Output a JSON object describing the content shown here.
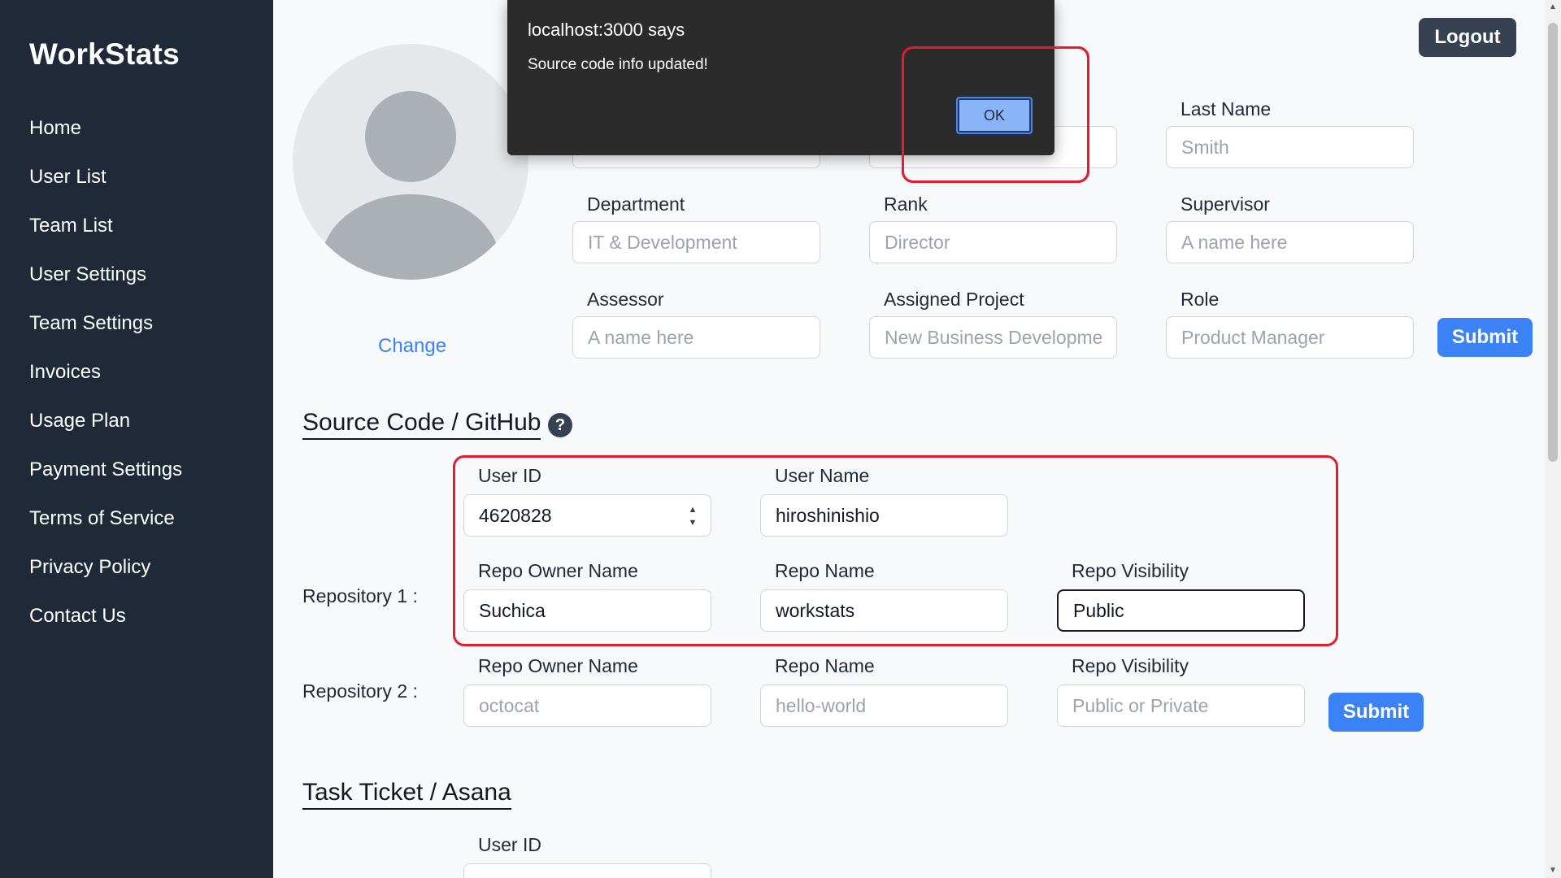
{
  "app": {
    "brand": "WorkStats"
  },
  "sidebar": {
    "items": [
      {
        "label": "Home"
      },
      {
        "label": "User List"
      },
      {
        "label": "Team List"
      },
      {
        "label": "User Settings"
      },
      {
        "label": "Team Settings"
      },
      {
        "label": "Invoices"
      },
      {
        "label": "Usage Plan"
      },
      {
        "label": "Payment Settings"
      },
      {
        "label": "Terms of Service"
      },
      {
        "label": "Privacy Policy"
      },
      {
        "label": "Contact Us"
      }
    ]
  },
  "header": {
    "logout_label": "Logout"
  },
  "profile": {
    "change_label": "Change",
    "last_name_label": "Last Name",
    "last_name_placeholder": "Smith",
    "department_label": "Department",
    "department_placeholder": "IT & Development",
    "rank_label": "Rank",
    "rank_placeholder": "Director",
    "supervisor_label": "Supervisor",
    "supervisor_placeholder": "A name here",
    "assessor_label": "Assessor",
    "assessor_placeholder": "A name here",
    "assigned_project_label": "Assigned Project",
    "assigned_project_placeholder": "New Business Developme",
    "role_label": "Role",
    "role_placeholder": "Product Manager",
    "submit_label": "Submit"
  },
  "source_code": {
    "title": "Source Code / GitHub",
    "help_icon": "?",
    "user_id_label": "User ID",
    "user_id_value": "4620828",
    "user_name_label": "User Name",
    "user_name_value": "hiroshinishio",
    "repo1": {
      "label": "Repository 1 :",
      "owner_label": "Repo Owner Name",
      "owner_value": "Suchica",
      "name_label": "Repo Name",
      "name_value": "workstats",
      "visibility_label": "Repo Visibility",
      "visibility_value": "Public"
    },
    "repo2": {
      "label": "Repository 2 :",
      "owner_label": "Repo Owner Name",
      "owner_placeholder": "octocat",
      "name_label": "Repo Name",
      "name_placeholder": "hello-world",
      "visibility_label": "Repo Visibility",
      "visibility_placeholder": "Public or Private"
    },
    "submit_label": "Submit"
  },
  "task_ticket": {
    "title": "Task Ticket / Asana",
    "user_id_label": "User ID"
  },
  "dialog": {
    "title": "localhost:3000 says",
    "message": "Source code info updated!",
    "ok_label": "OK"
  },
  "colors": {
    "sidebar_bg": "#1f2937",
    "accent": "#3b82f6",
    "highlight": "#e11d2e"
  }
}
